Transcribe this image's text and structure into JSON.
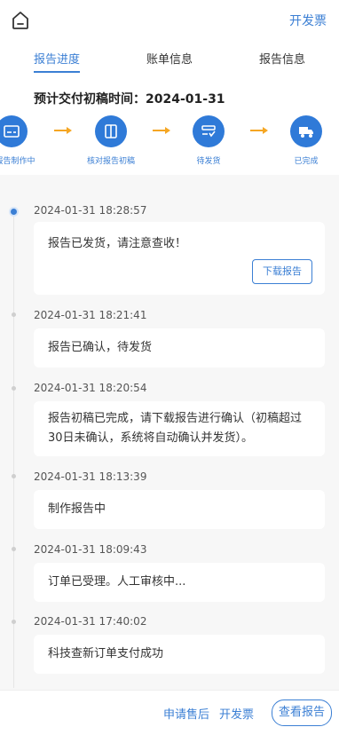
{
  "header": {
    "invoice_label": "开发票"
  },
  "tabs": [
    {
      "label": "报告进度"
    },
    {
      "label": "账单信息"
    },
    {
      "label": "报告信息"
    }
  ],
  "due": {
    "label": "预计交付初稿时间：2024-01-31"
  },
  "steps": [
    {
      "label": "报告制作中",
      "icon": "report-icon"
    },
    {
      "label": "核对报告初稿",
      "icon": "book-icon"
    },
    {
      "label": "待发货",
      "icon": "checklist-icon"
    },
    {
      "label": "已完成",
      "icon": "truck-icon"
    }
  ],
  "timeline": [
    {
      "time": "2024-01-31 18:28:57",
      "text": "报告已发货，请注意查收！",
      "button": "下载报告"
    },
    {
      "time": "2024-01-31 18:21:41",
      "text": "报告已确认，待发货"
    },
    {
      "time": "2024-01-31 18:20:54",
      "text": "报告初稿已完成，请下载报告进行确认（初稿超过30日未确认，系统将自动确认并发货）。"
    },
    {
      "time": "2024-01-31 18:13:39",
      "text": "制作报告中"
    },
    {
      "time": "2024-01-31 18:09:43",
      "text": "订单已受理。人工审核中..."
    },
    {
      "time": "2024-01-31 17:40:02",
      "text": "科技查新订单支付成功"
    }
  ],
  "footer": {
    "after_sale": "申请售后",
    "invoice": "开发票",
    "view_report": "查看报告"
  },
  "colors": {
    "accent": "#3b7fd4",
    "step": "#2f7ad8",
    "arrow": "#f5a623"
  }
}
